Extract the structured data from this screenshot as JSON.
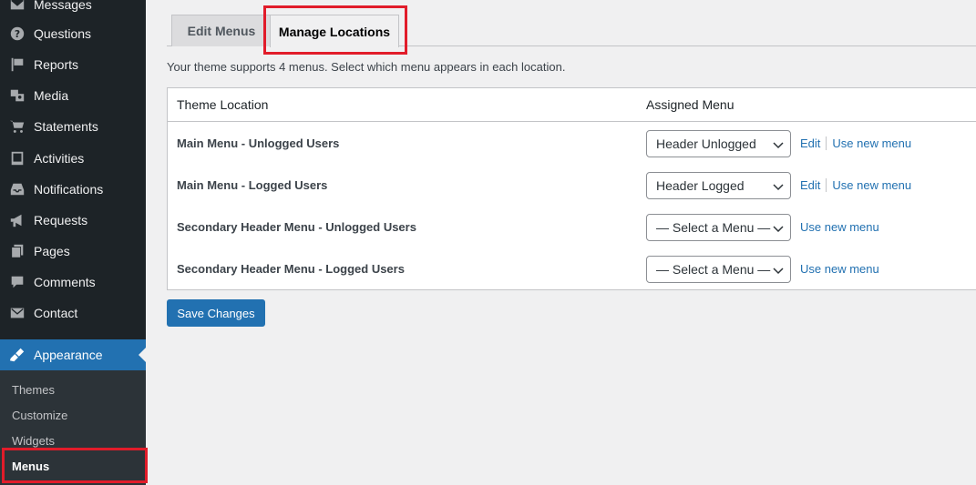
{
  "sidebar": {
    "items": [
      {
        "label": "Messages",
        "icon": "envelope-icon"
      },
      {
        "label": "Questions",
        "icon": "question-icon"
      },
      {
        "label": "Reports",
        "icon": "flag-icon"
      },
      {
        "label": "Media",
        "icon": "media-icon"
      },
      {
        "label": "Statements",
        "icon": "cart-icon"
      },
      {
        "label": "Activities",
        "icon": "book-icon"
      },
      {
        "label": "Notifications",
        "icon": "inbox-icon"
      },
      {
        "label": "Requests",
        "icon": "megaphone-icon"
      },
      {
        "label": "Pages",
        "icon": "pages-icon"
      },
      {
        "label": "Comments",
        "icon": "comment-icon"
      },
      {
        "label": "Contact",
        "icon": "envelope-icon"
      },
      {
        "label": "Appearance",
        "icon": "brush-icon",
        "active": true
      }
    ],
    "submenu": [
      {
        "label": "Themes"
      },
      {
        "label": "Customize"
      },
      {
        "label": "Widgets"
      },
      {
        "label": "Menus",
        "current": true
      }
    ]
  },
  "tabs": [
    {
      "label": "Edit Menus"
    },
    {
      "label": "Manage Locations",
      "active": true
    }
  ],
  "intro": "Your theme supports 4 menus. Select which menu appears in each location.",
  "table": {
    "headers": [
      "Theme Location",
      "Assigned Menu"
    ],
    "rows": [
      {
        "location": "Main Menu - Unlogged Users",
        "menu": "Header Unlogged",
        "edit": "Edit",
        "use_new": "Use new menu"
      },
      {
        "location": "Main Menu - Logged Users",
        "menu": "Header Logged",
        "edit": "Edit",
        "use_new": "Use new menu"
      },
      {
        "location": "Secondary Header Menu - Unlogged Users",
        "menu": "— Select a Menu —",
        "use_new": "Use new menu"
      },
      {
        "location": "Secondary Header Menu - Logged Users",
        "menu": "— Select a Menu —",
        "use_new": "Use new menu"
      }
    ]
  },
  "save_label": "Save Changes",
  "colors": {
    "accent": "#2271b1",
    "sidebar": "#1d2327",
    "highlight": "#e11c2a"
  }
}
